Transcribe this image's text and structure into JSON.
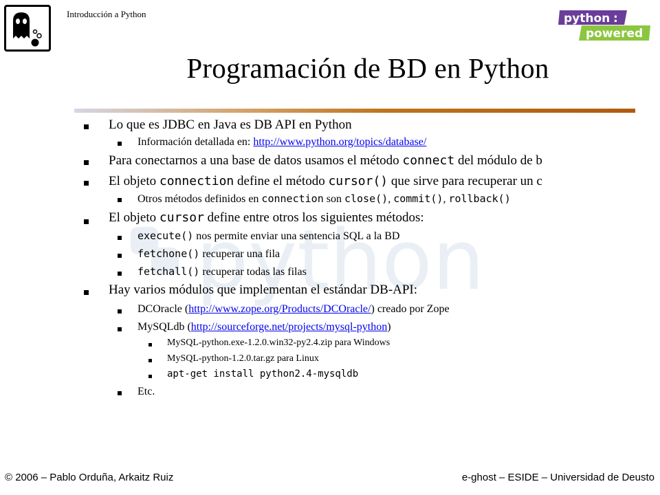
{
  "header": {
    "course": "Introducción a Python",
    "python_logo_top": "python",
    "python_logo_bottom": "powered"
  },
  "slide": {
    "title": "Programación de BD en Python"
  },
  "bullets": {
    "b1": "Lo que es JDBC en Java es DB API en Python",
    "b1_1_text": "Información detallada en: ",
    "b1_1_link": "http://www.python.org/topics/database/",
    "b2_text": "Para conectarnos a una base de datos usamos el método ",
    "b2_code": "connect",
    "b2_tail": " del módulo de b",
    "b3_a": "El objeto ",
    "b3_code1": "connection",
    "b3_b": " define el método ",
    "b3_code2": "cursor()",
    "b3_c": " que sirve para recuperar un c",
    "b3_1_a": "Otros métodos definidos en ",
    "b3_1_code1": "connection",
    "b3_1_b": " son ",
    "b3_1_code2": "close()",
    "b3_1_c": ", ",
    "b3_1_code3": "commit()",
    "b3_1_d": ", ",
    "b3_1_code4": "rollback()",
    "b4_a": "El objeto ",
    "b4_code": "cursor",
    "b4_b": " define entre otros los siguientes métodos:",
    "b4_1_code": "execute()",
    "b4_1_text": " nos permite enviar una sentencia SQL a la BD",
    "b4_2_code": "fetchone()",
    "b4_2_text": " recuperar una fila",
    "b4_3_code": "fetchall()",
    "b4_3_text": " recuperar todas las filas",
    "b5": "Hay varios módulos que implementan el estándar DB-API:",
    "b5_1_a": "DCOracle (",
    "b5_1_link": "http://www.zope.org/Products/DCOracle/",
    "b5_1_b": ")  creado por Zope",
    "b5_2_a": "MySQLdb (",
    "b5_2_link": "http://sourceforge.net/projects/mysql-python",
    "b5_2_b": ")",
    "b5_2_1": "MySQL-python.exe-1.2.0.win32-py2.4.zip  para Windows",
    "b5_2_2": "MySQL-python-1.2.0.tar.gz  para Linux",
    "b5_2_3": "apt-get install python2.4-mysqldb",
    "b5_3": "Etc."
  },
  "footer": {
    "left": "© 2006 – Pablo Orduña, Arkaitz Ruiz",
    "right": "e-ghost – ESIDE – Universidad de Deusto"
  },
  "colors": {
    "link": "#0000ee",
    "accent_bar": "#b25a0d",
    "python_logo_purple": "#6a3d9a",
    "python_logo_green": "#8cc63f"
  },
  "icons": {
    "ghost_logo": "ghost-icon",
    "bullets": "square-bullet-icon"
  }
}
